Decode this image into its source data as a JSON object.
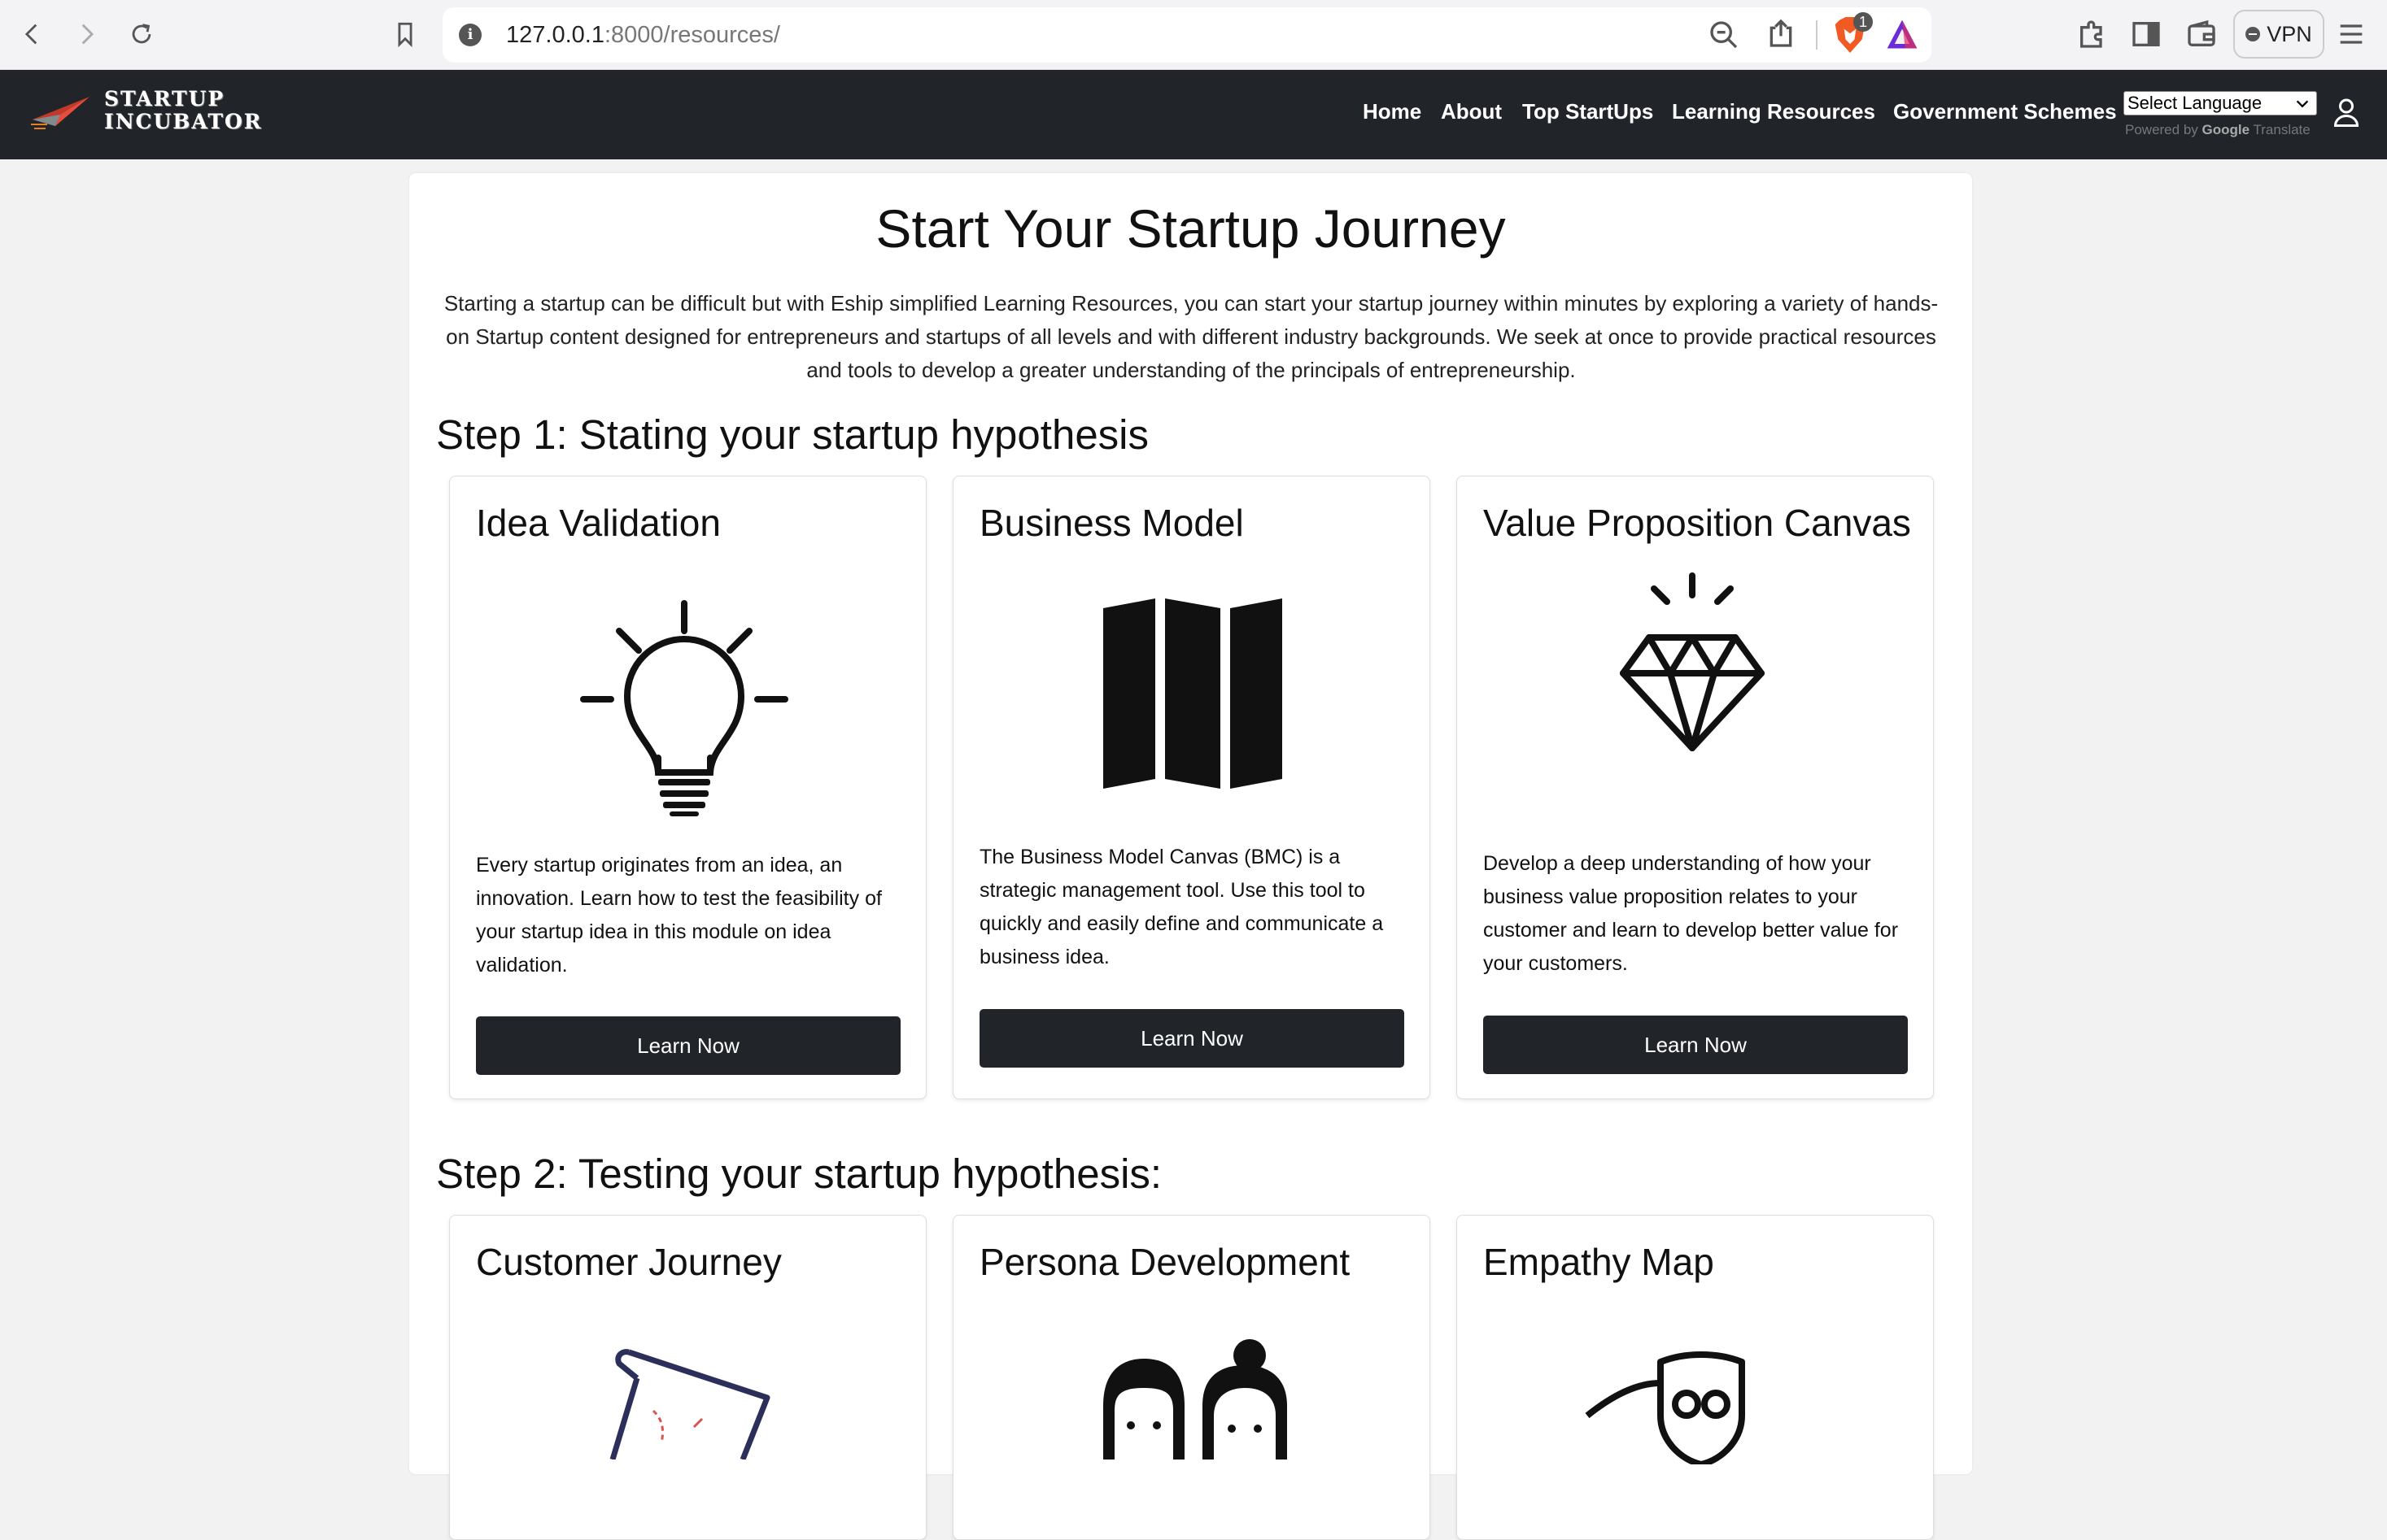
{
  "browser": {
    "url_host": "127.0.0.1",
    "url_path": ":8000/resources/",
    "shields_count": "1",
    "vpn_label": "VPN"
  },
  "site": {
    "logo_line1": "STARTUP",
    "logo_line2": "INCUBATOR",
    "nav": [
      "Home",
      "About",
      "Top StartUps",
      "Learning Resources",
      "Government Schemes"
    ],
    "language_select": "Select Language",
    "powered_by": "Powered by",
    "google": "Google",
    "translate": "Translate"
  },
  "page": {
    "title": "Start Your Startup Journey",
    "intro": "Starting a startup can be difficult but with Eship simplified Learning Resources, you can start your startup journey within minutes by exploring a variety of hands-on Startup content designed for entrepreneurs and startups of all levels and with different industry backgrounds. We seek at once to provide practical resources and tools to develop a greater understanding of the principals of entrepreneurship.",
    "step1": "Step 1: Stating your startup hypothesis",
    "step2": "Step 2: Testing your startup hypothesis:",
    "learn_label": "Learn Now",
    "cards1": [
      {
        "title": "Idea Validation",
        "desc": "Every startup originates from an idea, an innovation. Learn how to test the feasibility of your startup idea in this module on idea validation.",
        "icon": "lightbulb-icon"
      },
      {
        "title": "Business Model",
        "desc": "The Business Model Canvas (BMC) is a strategic management tool. Use this tool to quickly and easily define and communicate a business idea.",
        "icon": "map-icon"
      },
      {
        "title": "Value Proposition Canvas",
        "desc": "Develop a deep understanding of how your business value proposition relates to your customer and learn to develop better value for your customers.",
        "icon": "diamond-icon"
      }
    ],
    "cards2": [
      {
        "title": "Customer Journey",
        "icon": "journey-map-icon"
      },
      {
        "title": "Persona Development",
        "icon": "persona-icon"
      },
      {
        "title": "Empathy Map",
        "icon": "masks-icon"
      }
    ]
  }
}
